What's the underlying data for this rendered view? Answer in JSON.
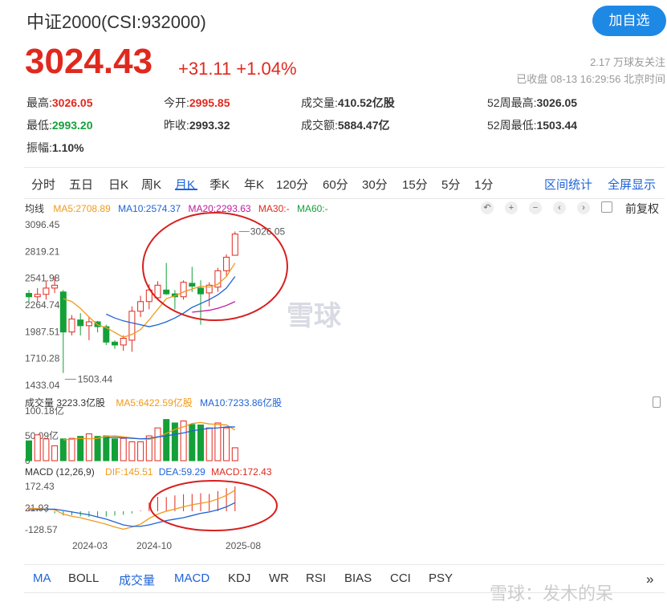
{
  "header": {
    "title": "中证2000(CSI:932000)",
    "follow_label": "加自选",
    "price": "3024.43",
    "change": "+31.11",
    "change_pct": "+1.04%",
    "followers": "2.17 万球友关注",
    "market_status": "已收盘 08-13 16:29:56 北京时间"
  },
  "stats": [
    {
      "label": "最高:",
      "value": "3026.05",
      "color": "red"
    },
    {
      "label": "今开:",
      "value": "2995.85",
      "color": "red"
    },
    {
      "label": "成交量:",
      "value": "410.52亿股",
      "color": "dark"
    },
    {
      "label": "52周最高:",
      "value": "3026.05",
      "color": "dark"
    },
    {
      "label": "最低:",
      "value": "2993.20",
      "color": "green"
    },
    {
      "label": "昨收:",
      "value": "2993.32",
      "color": "dark"
    },
    {
      "label": "成交额:",
      "value": "5884.47亿",
      "color": "dark"
    },
    {
      "label": "52周最低:",
      "value": "1503.44",
      "color": "dark"
    },
    {
      "label": "振幅:",
      "value": "1.10%",
      "color": "dark"
    }
  ],
  "period_tabs": [
    "分时",
    "五日",
    "日K",
    "周K",
    "月K",
    "季K",
    "年K",
    "120分",
    "60分",
    "30分",
    "15分",
    "5分",
    "1分"
  ],
  "active_tab": "月K",
  "right_links": [
    "区间统计",
    "全屏显示"
  ],
  "ma_legend": {
    "label": "均线",
    "ma5": "MA5:2708.89",
    "ma10": "MA10:2574.37",
    "ma20": "MA20:2293.63",
    "ma30": "MA30:-",
    "ma60": "MA60:-"
  },
  "price_adjust_label": "前复权",
  "volume_legend": {
    "label": "成交量 3223.3亿股",
    "ma5": "MA5:6422.59亿股",
    "ma10": "MA10:7233.86亿股"
  },
  "macd_legend": {
    "label": "MACD (12,26,9)",
    "dif": "DIF:145.51",
    "dea": "DEA:59.29",
    "macd": "MACD:172.43"
  },
  "indicator_tabs": [
    "MA",
    "BOLL",
    "成交量",
    "MACD",
    "KDJ",
    "WR",
    "RSI",
    "BIAS",
    "CCI",
    "PSY"
  ],
  "watermark_center": "雪球",
  "watermark_bottom": "雪球：发木的呆",
  "chart_data": {
    "type": "candlestick",
    "y_ticks": [
      "3096.45",
      "2819.21",
      "2541.98",
      "2264.74",
      "1987.51",
      "1710.28",
      "1433.04"
    ],
    "ylim": [
      1433.04,
      3096.45
    ],
    "max_label": "3026.05",
    "min_label": "1503.44",
    "volume_ticks": [
      "100.18亿",
      "50.09亿",
      "0"
    ],
    "macd_ticks": [
      "172.43",
      "21.93",
      "-128.57"
    ],
    "x_ticks": [
      "2024-03",
      "2024-10",
      "2025-08"
    ],
    "colors": {
      "up": "#e0291e",
      "down": "#14a038",
      "ma5": "#f09a1a",
      "ma10": "#1e63d8",
      "ma20": "#c0199c",
      "dif": "#f09a1a",
      "dea": "#1e63d8"
    },
    "candles": [
      {
        "o": 2385,
        "h": 2420,
        "l": 2290,
        "c": 2350
      },
      {
        "o": 2350,
        "h": 2440,
        "l": 2300,
        "c": 2375
      },
      {
        "o": 2375,
        "h": 2520,
        "l": 2320,
        "c": 2440
      },
      {
        "o": 2440,
        "h": 2560,
        "l": 2390,
        "c": 2470
      },
      {
        "o": 2400,
        "h": 2420,
        "l": 1560,
        "c": 1985
      },
      {
        "o": 1985,
        "h": 2160,
        "l": 1950,
        "c": 2120
      },
      {
        "o": 2110,
        "h": 2180,
        "l": 1950,
        "c": 2050
      },
      {
        "o": 2050,
        "h": 2140,
        "l": 1900,
        "c": 2090
      },
      {
        "o": 2090,
        "h": 2100,
        "l": 1980,
        "c": 2040
      },
      {
        "o": 2040,
        "h": 2060,
        "l": 1850,
        "c": 1880
      },
      {
        "o": 1880,
        "h": 1900,
        "l": 1810,
        "c": 1850
      },
      {
        "o": 1850,
        "h": 1950,
        "l": 1790,
        "c": 1920
      },
      {
        "o": 1900,
        "h": 2250,
        "l": 1780,
        "c": 2200
      },
      {
        "o": 2200,
        "h": 2360,
        "l": 2140,
        "c": 2300
      },
      {
        "o": 2300,
        "h": 2480,
        "l": 2220,
        "c": 2420
      },
      {
        "o": 2340,
        "h": 2510,
        "l": 2320,
        "c": 2470
      },
      {
        "o": 2420,
        "h": 2700,
        "l": 2370,
        "c": 2380
      },
      {
        "o": 2380,
        "h": 2420,
        "l": 2220,
        "c": 2350
      },
      {
        "o": 2350,
        "h": 2520,
        "l": 2320,
        "c": 2500
      },
      {
        "o": 2490,
        "h": 2660,
        "l": 2400,
        "c": 2460
      },
      {
        "o": 2440,
        "h": 2520,
        "l": 2060,
        "c": 2380
      },
      {
        "o": 2390,
        "h": 2500,
        "l": 2250,
        "c": 2470
      },
      {
        "o": 2450,
        "h": 2650,
        "l": 2400,
        "c": 2620
      },
      {
        "o": 2620,
        "h": 2790,
        "l": 2560,
        "c": 2760
      },
      {
        "o": 2780,
        "h": 3026,
        "l": 2780,
        "c": 3000
      }
    ],
    "ma5": [
      null,
      null,
      null,
      null,
      2330,
      2300,
      2230,
      2140,
      2060,
      2030,
      1980,
      1930,
      1960,
      2010,
      2110,
      2220,
      2330,
      2360,
      2400,
      2430,
      2460,
      2450,
      2480,
      2560,
      2700
    ],
    "ma10": [
      null,
      null,
      null,
      null,
      null,
      null,
      null,
      null,
      null,
      2170,
      2130,
      2100,
      2080,
      2060,
      2040,
      2060,
      2090,
      2130,
      2180,
      2240,
      2280,
      2320,
      2370,
      2440,
      2560
    ],
    "ma20": [
      null,
      null,
      null,
      null,
      null,
      null,
      null,
      null,
      null,
      null,
      null,
      null,
      null,
      null,
      null,
      null,
      null,
      null,
      null,
      2190,
      2200,
      2210,
      2230,
      2260,
      2300
    ],
    "volume": [
      40,
      52,
      44,
      30,
      44,
      45,
      49,
      54,
      49,
      50,
      44,
      45,
      38,
      38,
      50,
      66,
      83,
      76,
      80,
      73,
      72,
      66,
      76,
      66,
      26
    ],
    "vol_ma5": [
      null,
      null,
      null,
      null,
      42,
      43,
      45,
      44,
      45,
      49,
      50,
      48,
      46,
      44,
      43,
      47,
      55,
      63,
      68,
      75,
      77,
      74,
      73,
      72,
      62
    ],
    "vol_ma10": [
      null,
      null,
      null,
      null,
      null,
      null,
      null,
      null,
      null,
      46,
      47,
      46,
      45,
      44,
      45,
      48,
      50,
      53,
      56,
      60,
      63,
      65,
      66,
      68,
      68
    ],
    "macd": [
      18,
      10,
      -8,
      -15,
      -30,
      -28,
      -35,
      -40,
      -40,
      -38,
      -30,
      -25,
      -15,
      5,
      60,
      100,
      98,
      110,
      118,
      120,
      125,
      120,
      140,
      160,
      172.43
    ],
    "dif": [
      21,
      18,
      15,
      10,
      -20,
      -35,
      -45,
      -60,
      -75,
      -90,
      -110,
      -125,
      -110,
      -90,
      -50,
      -20,
      0,
      15,
      30,
      45,
      55,
      65,
      85,
      110,
      145.51
    ],
    "dea": [
      10,
      12,
      14,
      14,
      5,
      -5,
      -15,
      -25,
      -40,
      -55,
      -75,
      -95,
      -105,
      -105,
      -95,
      -80,
      -65,
      -55,
      -45,
      -30,
      -15,
      -5,
      10,
      30,
      59.29
    ]
  }
}
